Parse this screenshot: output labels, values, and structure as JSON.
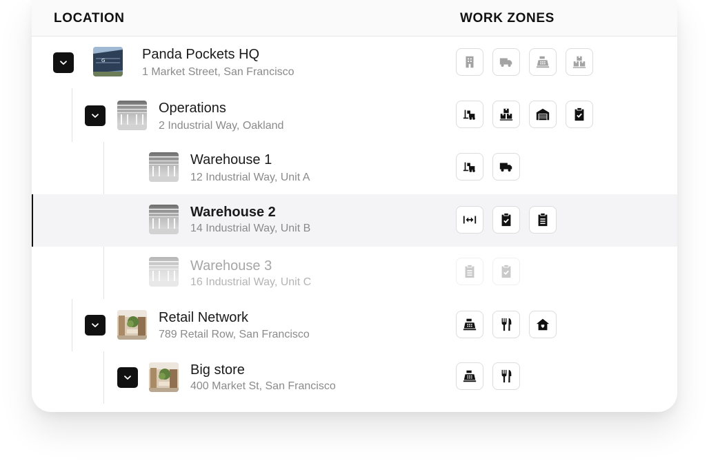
{
  "header": {
    "location_label": "LOCATION",
    "zones_label": "WORK ZONES"
  },
  "rows": [
    {
      "name": "Panda Pockets HQ",
      "address": "1 Market Street, San Francisco",
      "zones": [
        "building-icon",
        "delivery-truck-icon",
        "cash-register-icon",
        "boxes-icon"
      ]
    },
    {
      "name": "Operations",
      "address": "2 Industrial Way, Oakland",
      "zones": [
        "forklift-icon",
        "boxes-icon",
        "warehouse-icon",
        "clipboard-check-icon"
      ]
    },
    {
      "name": "Warehouse 1",
      "address": "12 Industrial Way, Unit A",
      "zones": [
        "forklift-icon",
        "delivery-truck-icon"
      ]
    },
    {
      "name": "Warehouse 2",
      "address": "14 Industrial Way, Unit B",
      "zones": [
        "width-arrows-icon",
        "clipboard-check-icon",
        "clipboard-list-icon"
      ]
    },
    {
      "name": "Warehouse 3",
      "address": "16 Industrial Way, Unit C",
      "zones": [
        "clipboard-list-icon",
        "clipboard-check-icon"
      ]
    },
    {
      "name": "Retail Network",
      "address": "789 Retail Row, San Francisco",
      "zones": [
        "cash-register-icon",
        "utensils-icon",
        "house-icon"
      ]
    },
    {
      "name": "Big store",
      "address": "400 Market St, San Francisco",
      "zones": [
        "cash-register-icon",
        "utensils-icon"
      ]
    }
  ],
  "colors": {
    "accent": "#111111",
    "muted_text": "#8a8a8a",
    "selected_bg": "#f4f4f6"
  }
}
